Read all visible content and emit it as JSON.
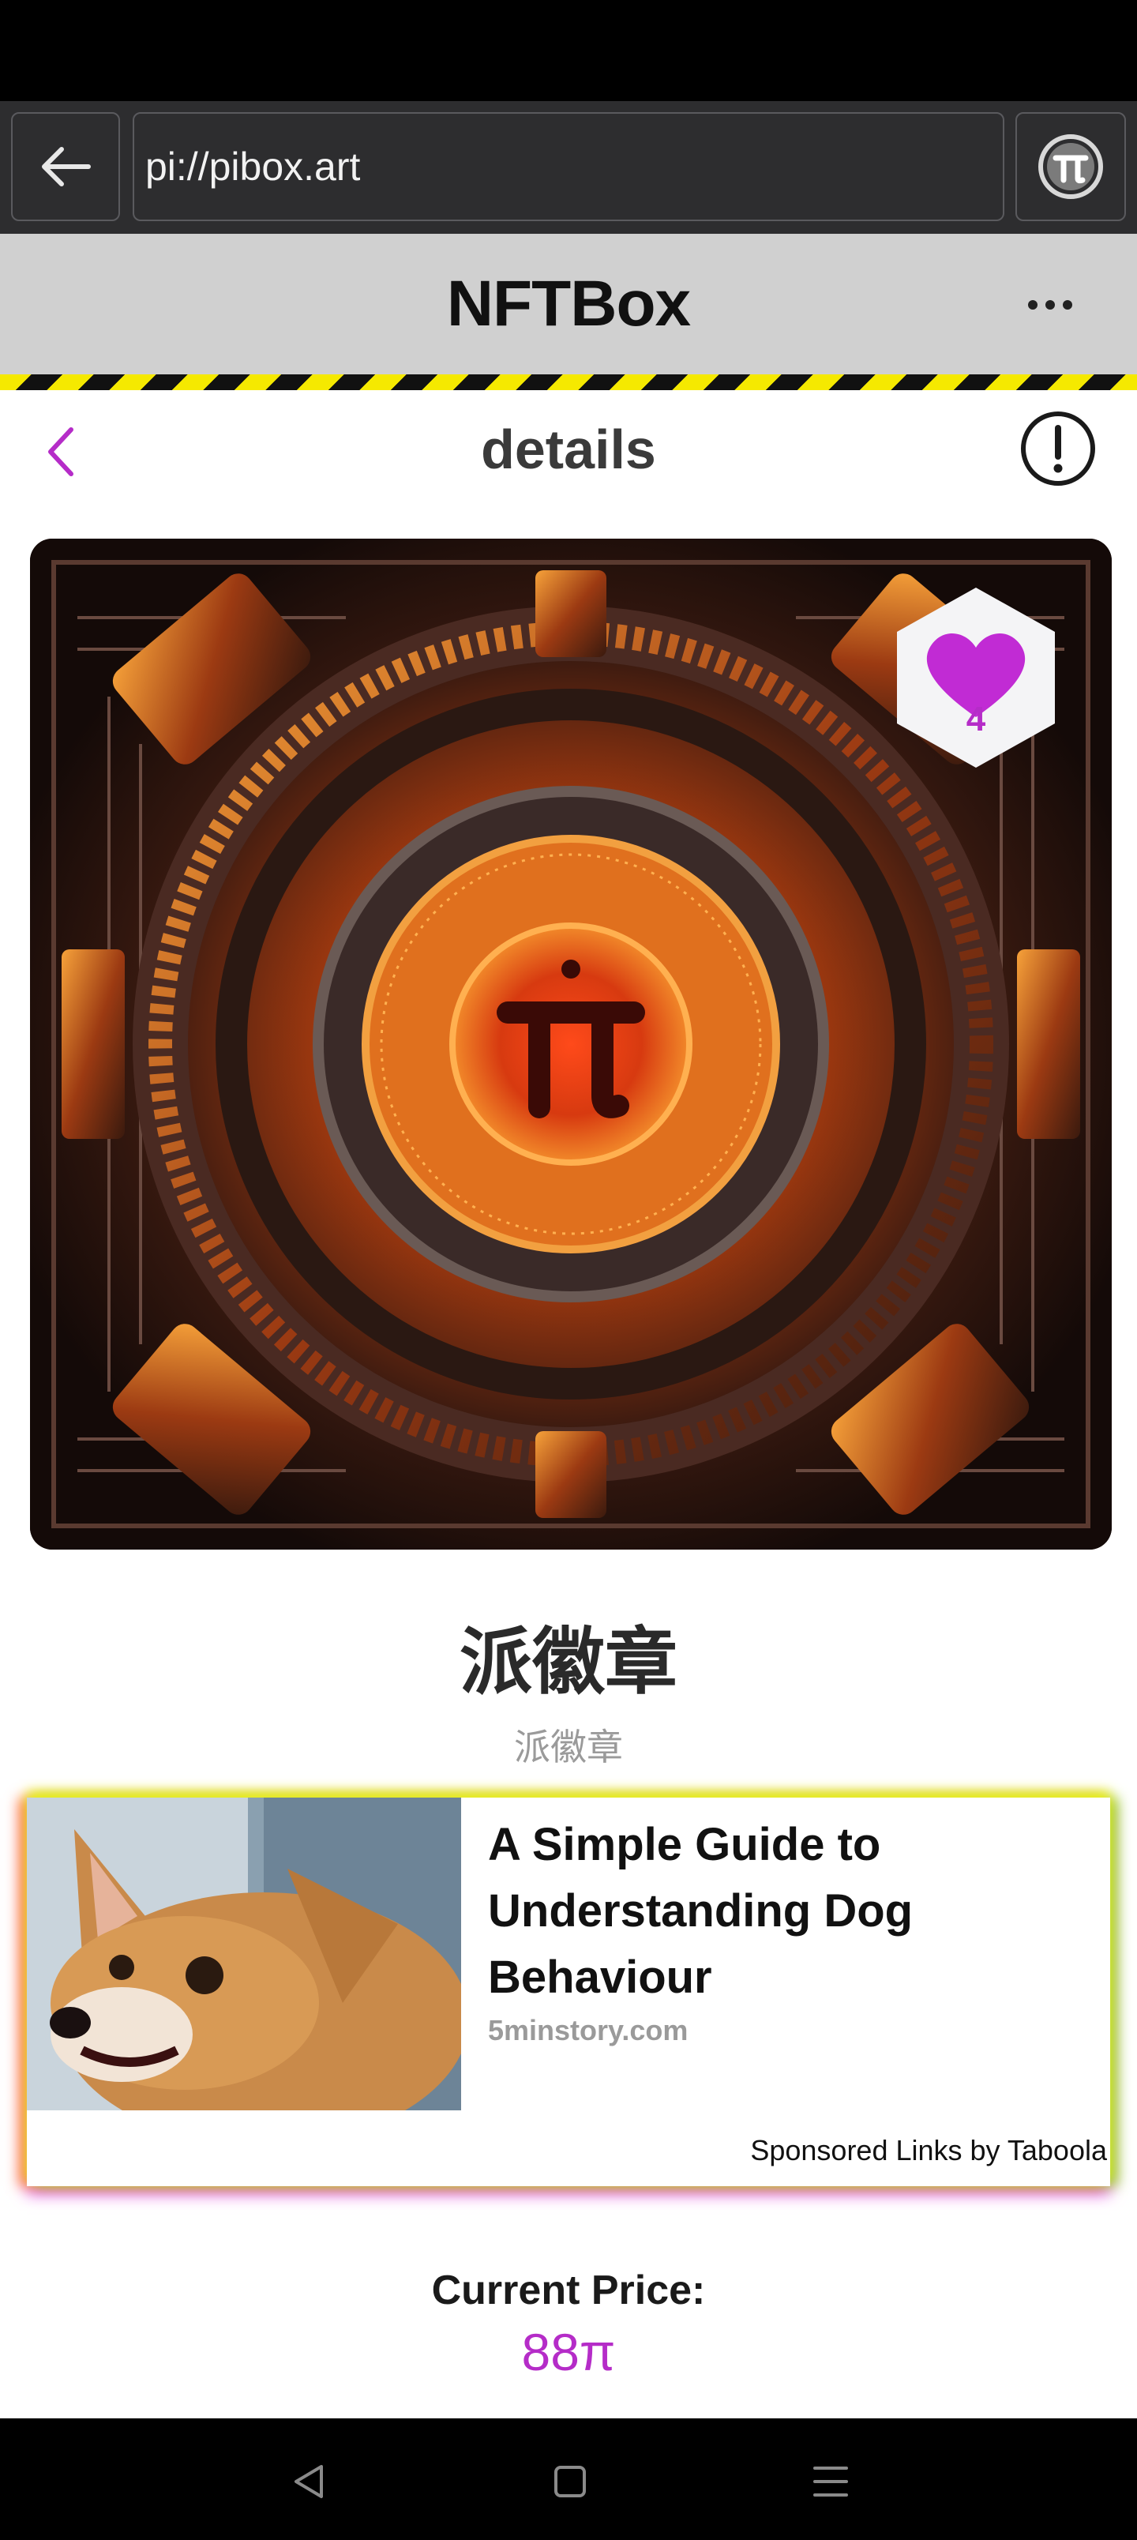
{
  "browser": {
    "url": "pi://pibox.art",
    "back_icon": "arrow-left-icon",
    "pi_icon": "pi-logo-icon"
  },
  "header": {
    "title": "NFTBox",
    "more_icon": "more-horizontal-icon"
  },
  "details": {
    "title": "details",
    "back_icon": "chevron-left-icon",
    "info_icon": "alert-circle-icon"
  },
  "nft": {
    "name": "派徽章",
    "subtitle": "派徽章",
    "likes": "4",
    "like_icon": "heart-icon"
  },
  "ad": {
    "headline": "A Simple Guide to Understanding Dog Behaviour",
    "source": "5minstory.com",
    "sponsored": "Sponsored Links by Taboola"
  },
  "price": {
    "label": "Current Price:",
    "value": "88π"
  },
  "colors": {
    "accent": "#b52cc8",
    "header_bg": "#d0d0d0",
    "url_bar_bg": "#2d2d2f"
  },
  "system_nav": {
    "back_icon": "triangle-back-icon",
    "home_icon": "square-home-icon",
    "menu_icon": "menu-lines-icon"
  }
}
